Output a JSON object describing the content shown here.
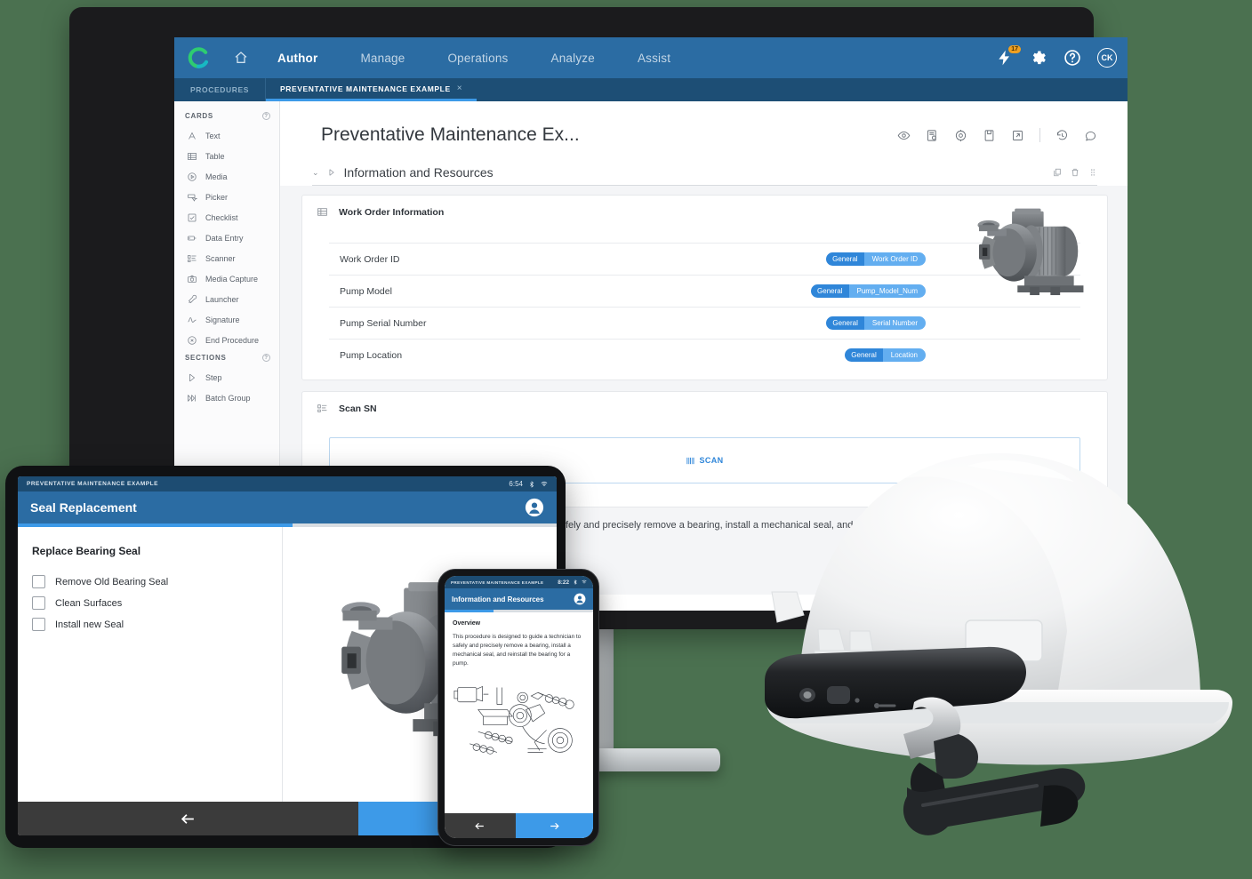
{
  "colors": {
    "background": "#4b7150",
    "nav_blue": "#2b6ca3",
    "tabstrip_blue": "#1d4e75",
    "accent_blue": "#3d9ae8",
    "tag_key": "#2f86d9",
    "tag_value": "#63aef0",
    "badge_orange": "#f0a020",
    "logo_green": "#2ecc71"
  },
  "desktop": {
    "topnav": {
      "logo": "brand-c-logo",
      "home_icon": "home-icon",
      "links": [
        {
          "label": "Author",
          "active": true
        },
        {
          "label": "Manage",
          "active": false
        },
        {
          "label": "Operations",
          "active": false
        },
        {
          "label": "Analyze",
          "active": false
        },
        {
          "label": "Assist",
          "active": false
        }
      ],
      "right_icons": [
        {
          "name": "bolt-icon",
          "badge": "17"
        },
        {
          "name": "gear-icon",
          "badge": ""
        },
        {
          "name": "help-icon",
          "badge": ""
        }
      ],
      "avatar_initials": "CK"
    },
    "tabstrip": {
      "procedures_label": "PROCEDURES",
      "open_tab_label": "PREVENTATIVE MAINTENANCE EXAMPLE",
      "close_glyph": "×"
    },
    "sidebar": {
      "cards_header": "CARDS",
      "cards_help": "?",
      "cards": [
        {
          "label": "Text",
          "icon": "text-icon"
        },
        {
          "label": "Table",
          "icon": "table-icon"
        },
        {
          "label": "Media",
          "icon": "media-icon"
        },
        {
          "label": "Picker",
          "icon": "picker-icon"
        },
        {
          "label": "Checklist",
          "icon": "checklist-icon"
        },
        {
          "label": "Data Entry",
          "icon": "data-entry-icon"
        },
        {
          "label": "Scanner",
          "icon": "scanner-icon"
        },
        {
          "label": "Media Capture",
          "icon": "media-capture-icon"
        },
        {
          "label": "Launcher",
          "icon": "launcher-icon"
        },
        {
          "label": "Signature",
          "icon": "signature-icon"
        },
        {
          "label": "End Procedure",
          "icon": "end-procedure-icon"
        }
      ],
      "sections_header": "SECTIONS",
      "sections_help": "?",
      "sections": [
        {
          "label": "Step",
          "icon": "step-icon"
        },
        {
          "label": "Batch Group",
          "icon": "batch-group-icon"
        }
      ]
    },
    "document": {
      "title": "Preventative Maintenance Ex...",
      "toolbar_icons": [
        "preview-eye-icon",
        "publish-icon",
        "settings-gear-icon",
        "save-icon",
        "open-external-icon",
        "history-icon",
        "comment-icon"
      ],
      "section": {
        "caret": "⌄",
        "title": "Information and Resources",
        "actions": [
          "duplicate-icon",
          "delete-icon",
          "drag-handle-icon"
        ]
      },
      "work_order_card": {
        "title": "Work Order Information",
        "icon": "table-icon",
        "image": "pump-3d-render",
        "rows": [
          {
            "label": "Work Order ID",
            "tag_key": "General",
            "tag_value": "Work Order ID"
          },
          {
            "label": "Pump Model",
            "tag_key": "General",
            "tag_value": "Pump_Model_Num"
          },
          {
            "label": "Pump Serial Number",
            "tag_key": "General",
            "tag_value": "Serial Number"
          },
          {
            "label": "Pump Location",
            "tag_key": "General",
            "tag_value": "Location"
          }
        ]
      },
      "scan_card": {
        "title": "Scan SN",
        "icon": "scanner-icon",
        "scan_button_label": "SCAN",
        "scan_button_icon": "barcode-icon"
      },
      "description": "This procedure is designed to guide a technician to safely and precisely remove a bearing, install a mechanical seal, and reinstall the bearing for a pump."
    }
  },
  "tablet": {
    "status": {
      "app_name": "PREVENTATIVE MAINTENANCE EXAMPLE",
      "time": "6:54",
      "icons": [
        "bluetooth-icon",
        "wifi-icon"
      ]
    },
    "appbar": {
      "title": "Seal Replacement",
      "avatar_icon": "user-avatar-icon"
    },
    "progress_percent": 51,
    "content": {
      "heading": "Replace Bearing Seal",
      "checklist": [
        {
          "label": "Remove Old Bearing Seal",
          "checked": false
        },
        {
          "label": "Clean Surfaces",
          "checked": false
        },
        {
          "label": "Install new Seal",
          "checked": false
        }
      ],
      "image": "pump-3d-render"
    },
    "nav": {
      "back_icon": "arrow-left-icon",
      "forward_icon": "arrow-right-icon"
    }
  },
  "phone": {
    "status": {
      "app_name": "PREVENTATIVE MAINTENANCE EXAMPLE",
      "time": "8:22",
      "icons": [
        "bluetooth-icon",
        "wifi-icon"
      ]
    },
    "appbar": {
      "title": "Information and Resources",
      "avatar_icon": "user-avatar-icon"
    },
    "progress_percent": 33,
    "content": {
      "heading": "Overview",
      "paragraph": "This procedure is designed to guide a technician to safely and precisely remove a bearing, install a mechanical seal, and reinstall the bearing for a pump.",
      "image": "pump-exploded-diagram"
    },
    "nav": {
      "back_icon": "arrow-left-icon",
      "forward_icon": "arrow-right-icon"
    }
  },
  "hardware": {
    "helmet": "white-hard-hat",
    "wearable": "head-mounted-display-device",
    "monitor": "desktop-monitor"
  }
}
